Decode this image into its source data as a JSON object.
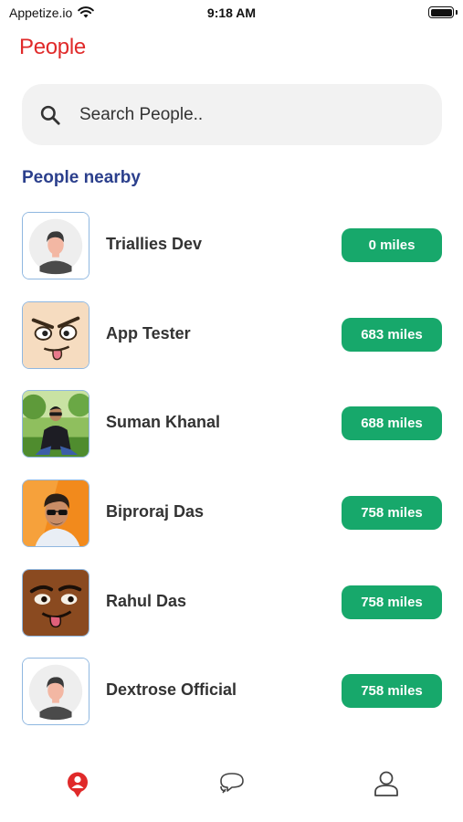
{
  "status_bar": {
    "carrier": "Appetize.io",
    "time": "9:18 AM",
    "wifi_icon": "wifi-icon",
    "battery_icon": "battery-icon"
  },
  "header": {
    "title": "People"
  },
  "search": {
    "placeholder": "Search People..",
    "value": "",
    "icon": "search-icon"
  },
  "section": {
    "title": "People nearby"
  },
  "people": [
    {
      "name": "Triallies Dev",
      "distance": "0 miles",
      "avatar": "default-avatar"
    },
    {
      "name": "App Tester",
      "distance": "683 miles",
      "avatar": "cartoon-face-tongue"
    },
    {
      "name": "Suman Khanal",
      "distance": "688 miles",
      "avatar": "photo-man-in-park"
    },
    {
      "name": "Biproraj Das",
      "distance": "758 miles",
      "avatar": "photo-man-sunglasses"
    },
    {
      "name": "Rahul Das",
      "distance": "758 miles",
      "avatar": "cartoon-face-brown"
    },
    {
      "name": "Dextrose Official",
      "distance": "758 miles",
      "avatar": "default-avatar"
    }
  ],
  "tab_bar": {
    "tabs": [
      {
        "icon": "people-icon",
        "active": true
      },
      {
        "icon": "chat-icon",
        "active": false
      },
      {
        "icon": "profile-icon",
        "active": false
      }
    ]
  },
  "colors": {
    "title_red": "#e02a2a",
    "section_blue": "#2b3f8c",
    "badge_green": "#17a86b",
    "search_bg": "#f2f2f2"
  }
}
